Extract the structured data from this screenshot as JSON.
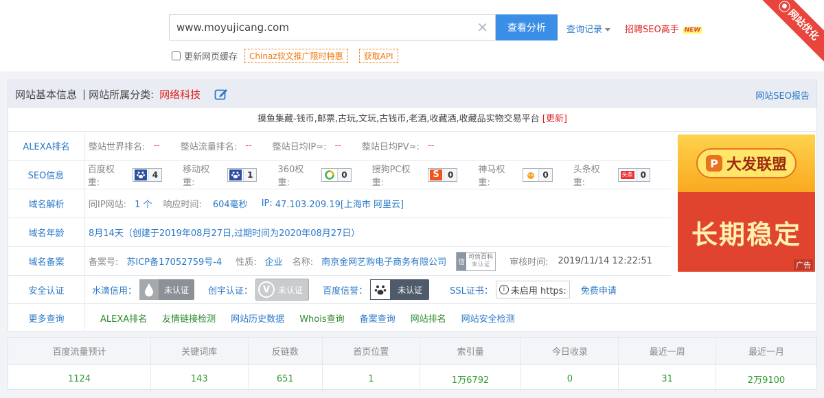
{
  "search": {
    "value": "www.moyujicang.com",
    "button": "查看分析",
    "history": "查询记录",
    "hire": "招聘SEO高手",
    "new_badge": "NEW",
    "cache_label": "更新网页缓存",
    "promo_tag": "Chinaz软文推广限时特惠",
    "api_tag": "获取API",
    "corner_ribbon": "网站优化"
  },
  "panel": {
    "title": "网站基本信息",
    "category_label": "网站所属分类:",
    "category": "网络科技",
    "seo_report": "网站SEO报告",
    "description": "摸鱼集藏-钱币,邮票,古玩,文玩,古钱币,老酒,收藏酒,收藏品实物交易平台",
    "update": "[更新]"
  },
  "alexa": {
    "label": "ALEXA排名",
    "items": [
      {
        "k": "整站世界排名:",
        "v": "--"
      },
      {
        "k": "整站流量排名:",
        "v": "--"
      },
      {
        "k": "整站日均IP≈:",
        "v": "--"
      },
      {
        "k": "整站日均PV≈:",
        "v": "--"
      }
    ]
  },
  "seo": {
    "label": "SEO信息",
    "items": [
      {
        "k": "百度权重:",
        "v": "4",
        "icon": "baidu-paw-icon"
      },
      {
        "k": "移动权重:",
        "v": "1",
        "icon": "baidu-paw-icon"
      },
      {
        "k": "360权重:",
        "v": "0",
        "icon": "360-icon"
      },
      {
        "k": "搜狗PC权重:",
        "v": "0",
        "icon": "sogou-icon"
      },
      {
        "k": "神马权重:",
        "v": "0",
        "icon": "shenma-icon"
      },
      {
        "k": "头条权重:",
        "v": "0",
        "icon": "toutiao-icon",
        "icon_text": "头条"
      }
    ]
  },
  "dns": {
    "label": "域名解析",
    "same_ip_label": "同IP网站:",
    "same_ip": "1 个",
    "resp_label": "响应时间:",
    "resp": "604毫秒",
    "ip_label": "IP:",
    "ip": "47.103.209.19[上海市 阿里云]"
  },
  "age": {
    "label": "域名年龄",
    "value": "8月14天（创建于2019年08月27日,过期时间为2020年08月27日）"
  },
  "icp": {
    "label": "域名备案",
    "no_label": "备案号:",
    "no": "苏ICP备17052759号-4",
    "nature_label": "性质:",
    "nature": "企业",
    "name_label": "名称:",
    "name": "南京金网艺购电子商务有限公司",
    "baike_top": "可信百科",
    "baike_bottom": "未认证",
    "baike_icon_text": "信",
    "audit_label": "审核时间:",
    "audit": "2019/11/14 12:22:51"
  },
  "security": {
    "label": "安全认证",
    "shuidi_label": "水滴信用：",
    "shuidi_badge": "未认证",
    "chuangyu_label": "创宇认证：",
    "chuangyu_badge": "未认证",
    "chuangyu_icon_text": "V",
    "baidu_label": "百度信誉：",
    "baidu_badge": "未认证",
    "ssl_label": "SSL证书：",
    "ssl_value": "未启用 https:",
    "ssl_icon_text": "i",
    "free_apply": "免费申请"
  },
  "more": {
    "label": "更多查询",
    "links": [
      "ALEXA排名",
      "友情链接检测",
      "网站历史数据",
      "Whois查询",
      "备案查询",
      "网站排名",
      "网站安全检测"
    ],
    "link_colors": [
      "#2e8a2e",
      "#2e8a2e",
      "#2a78c8",
      "#2e8a2e",
      "#2a78c8",
      "#2e8a2e",
      "#2a78c8"
    ]
  },
  "ad": {
    "brand": "大发联盟",
    "brand_icon_text": "P",
    "slogan": "长期稳定",
    "tag": "广告"
  },
  "stats": {
    "headers": [
      "百度流量预计",
      "关键词库",
      "反链数",
      "首页位置",
      "索引量",
      "今日收录",
      "最近一周",
      "最近一月"
    ],
    "values": [
      "1124",
      "143",
      "651",
      "1",
      "1万6792",
      "0",
      "31",
      "2万9100"
    ]
  },
  "colors": {
    "accent": "#3a8ee6",
    "link": "#2a78c8",
    "red": "#e02020",
    "green": "#2e9a2e"
  }
}
